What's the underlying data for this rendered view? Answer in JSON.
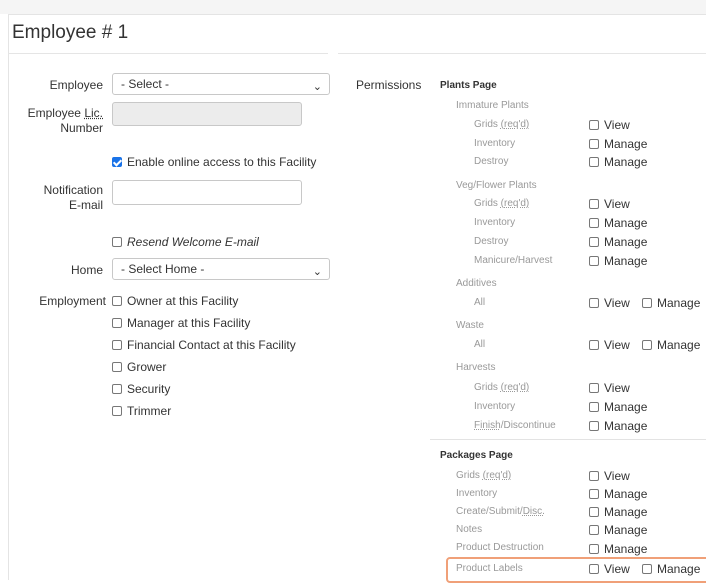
{
  "form": {
    "title": "Employee # 1",
    "employee_label": "Employee",
    "employee_select": "- Select -",
    "lic_label_a": "Employee ",
    "lic_label_b": "Lic.",
    "lic_label_c": "Number",
    "enable_online": "Enable online access to this Facility",
    "notif_label_a": "Notification",
    "notif_label_b": "E-mail",
    "resend": "Resend Welcome E-mail",
    "home_label": "Home",
    "home_select": "- Select Home -",
    "employment_label": "Employment",
    "employment_options": [
      "Owner at this Facility",
      "Manager at this Facility",
      "Financial Contact at this Facility",
      "Grower",
      "Security",
      "Trimmer"
    ]
  },
  "permissions": {
    "label": "Permissions",
    "plants_page": "Plants Page",
    "immature_plants": "Immature Plants",
    "grids_a": "Grids ",
    "reqd": "(req'd)",
    "inventory": "Inventory",
    "destroy": "Destroy",
    "veg_flower": "Veg/Flower Plants",
    "manicure": "Manicure/Harvest",
    "additives": "Additives",
    "all": "All",
    "waste": "Waste",
    "harvests": "Harvests",
    "finish_a": "Finish",
    "finish_b": "/Discontinue",
    "packages_page": "Packages Page",
    "create_a": "Create/Submit/",
    "create_b": "Disc.",
    "notes": "Notes",
    "product_destruction": "Product Destruction",
    "product_labels": "Product Labels",
    "view": "View",
    "manage": "Manage"
  }
}
